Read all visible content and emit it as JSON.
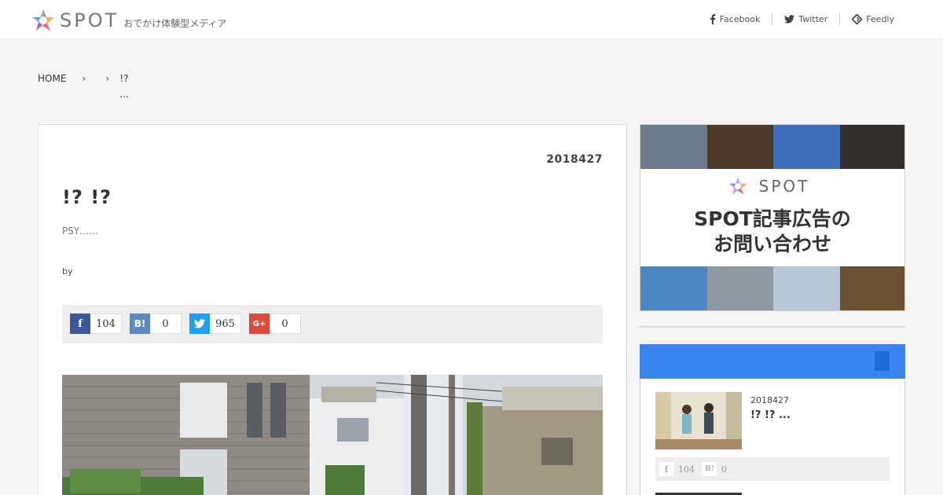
{
  "header": {
    "logo_text": "SPOT",
    "tagline": "おでかけ体験型メディア",
    "social": [
      {
        "label": "Facebook",
        "icon": "facebook-icon"
      },
      {
        "label": "Twitter",
        "icon": "twitter-icon"
      },
      {
        "label": "Feedly",
        "icon": "feedly-icon"
      }
    ]
  },
  "breadcrumb": {
    "home": "HOME",
    "sep": "›",
    "current_line1": "!?",
    "current_line2": "..."
  },
  "article": {
    "date": "2018427",
    "title": "!? !?",
    "excerpt": "PSY……",
    "byline": "by",
    "shares": [
      {
        "service": "facebook",
        "icon_text": "f",
        "count": "104",
        "color": "#3b5998"
      },
      {
        "service": "hatena",
        "icon_text": "B!",
        "count": "0",
        "color": "#5d8ac1"
      },
      {
        "service": "twitter",
        "icon_text": "",
        "count": "965",
        "color": "#1da1f2"
      },
      {
        "service": "googleplus",
        "icon_text": "G+",
        "count": "0",
        "color": "#dd4b39"
      }
    ]
  },
  "sidebar": {
    "ad": {
      "logo_text": "SPOT",
      "line1": "SPOT記事広告の",
      "line2": "お問い合わせ"
    },
    "ranking": {
      "accent": "#3b86ee",
      "item": {
        "date": "2018427",
        "title": "!? !? ...",
        "fb_icon": "f",
        "fb_count": "104",
        "hb_icon": "B!",
        "hb_count": "0"
      }
    }
  }
}
